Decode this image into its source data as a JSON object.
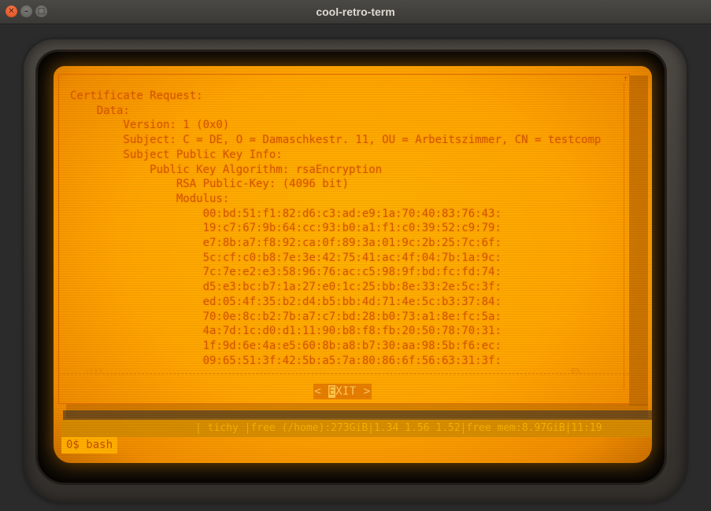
{
  "window": {
    "title": "cool-retro-term",
    "close_glyph": "✕",
    "min_glyph": "–",
    "max_glyph": "□"
  },
  "dialog": {
    "lines": [
      "Certificate Request:",
      "    Data:",
      "        Version: 1 (0x0)",
      "        Subject: C = DE, O = Damaschkestr. 11, OU = Arbeitszimmer, CN = testcomp",
      "        Subject Public Key Info:",
      "            Public Key Algorithm: rsaEncryption",
      "                RSA Public-Key: (4096 bit)",
      "                Modulus:",
      "                    00:bd:51:f1:82:d6:c3:ad:e9:1a:70:40:83:76:43:",
      "                    19:c7:67:9b:64:cc:93:b0:a1:f1:c0:39:52:c9:79:",
      "                    e7:8b:a7:f8:92:ca:0f:89:3a:01:9c:2b:25:7c:6f:",
      "                    5c:cf:c0:b8:7e:3e:42:75:41:ac:4f:04:7b:1a:9c:",
      "                    7c:7e:e2:e3:58:96:76:ac:c5:98:9f:bd:fc:fd:74:",
      "                    d5:e3:bc:b7:1a:27:e0:1c:25:bb:8e:33:2e:5c:3f:",
      "                    ed:05:4f:35:b2:d4:b5:bb:4d:71:4e:5c:b3:37:84:",
      "                    70:0e:8c:b2:7b:a7:c7:bd:28:b0:73:a1:8e:fc:5a:",
      "                    4a:7d:1c:d0:d1:11:90:b8:f8:fb:20:50:78:70:31:",
      "                    1f:9d:6e:4a:e5:60:8b:a8:b7:30:aa:98:5b:f6:ec:",
      "                    09:65:51:3f:42:5b:a5:7a:80:86:6f:56:63:31:3f:"
    ],
    "scroll_top_marker": "↑",
    "separator_left": "↓(+)",
    "separator_right": "8%",
    "exit_prefix": "< ",
    "exit_cursor": "E",
    "exit_rest": "XIT >"
  },
  "statusbar": {
    "text": "| tichy |free (/home):273GiB|1.34 1.56 1.52|free mem:8.97GiB|11:19"
  },
  "prompt": {
    "text": "0$ bash"
  }
}
